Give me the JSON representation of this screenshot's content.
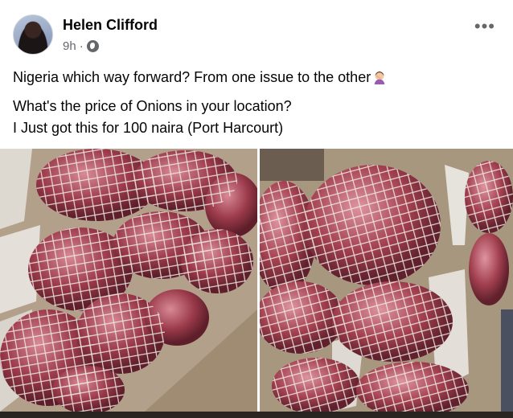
{
  "post": {
    "author": "Helen Clifford",
    "time": "9h",
    "separator": "·",
    "privacy_icon": "globe-icon",
    "more_icon": "more-options-icon",
    "more_glyph": "•••",
    "line1": "Nigeria which way forward? From one issue to the other",
    "line1_emoji": "person-facepalming-emoji",
    "line2": "What's the price of Onions in your location?",
    "line3": "I Just got this for 100 naira (Port Harcourt)"
  },
  "photos": [
    {
      "name": "onion-bags-photo-left"
    },
    {
      "name": "onion-bags-photo-right"
    }
  ],
  "colors": {
    "text": "#050505",
    "secondary": "#65676b",
    "onion": "#9b3a4a"
  }
}
